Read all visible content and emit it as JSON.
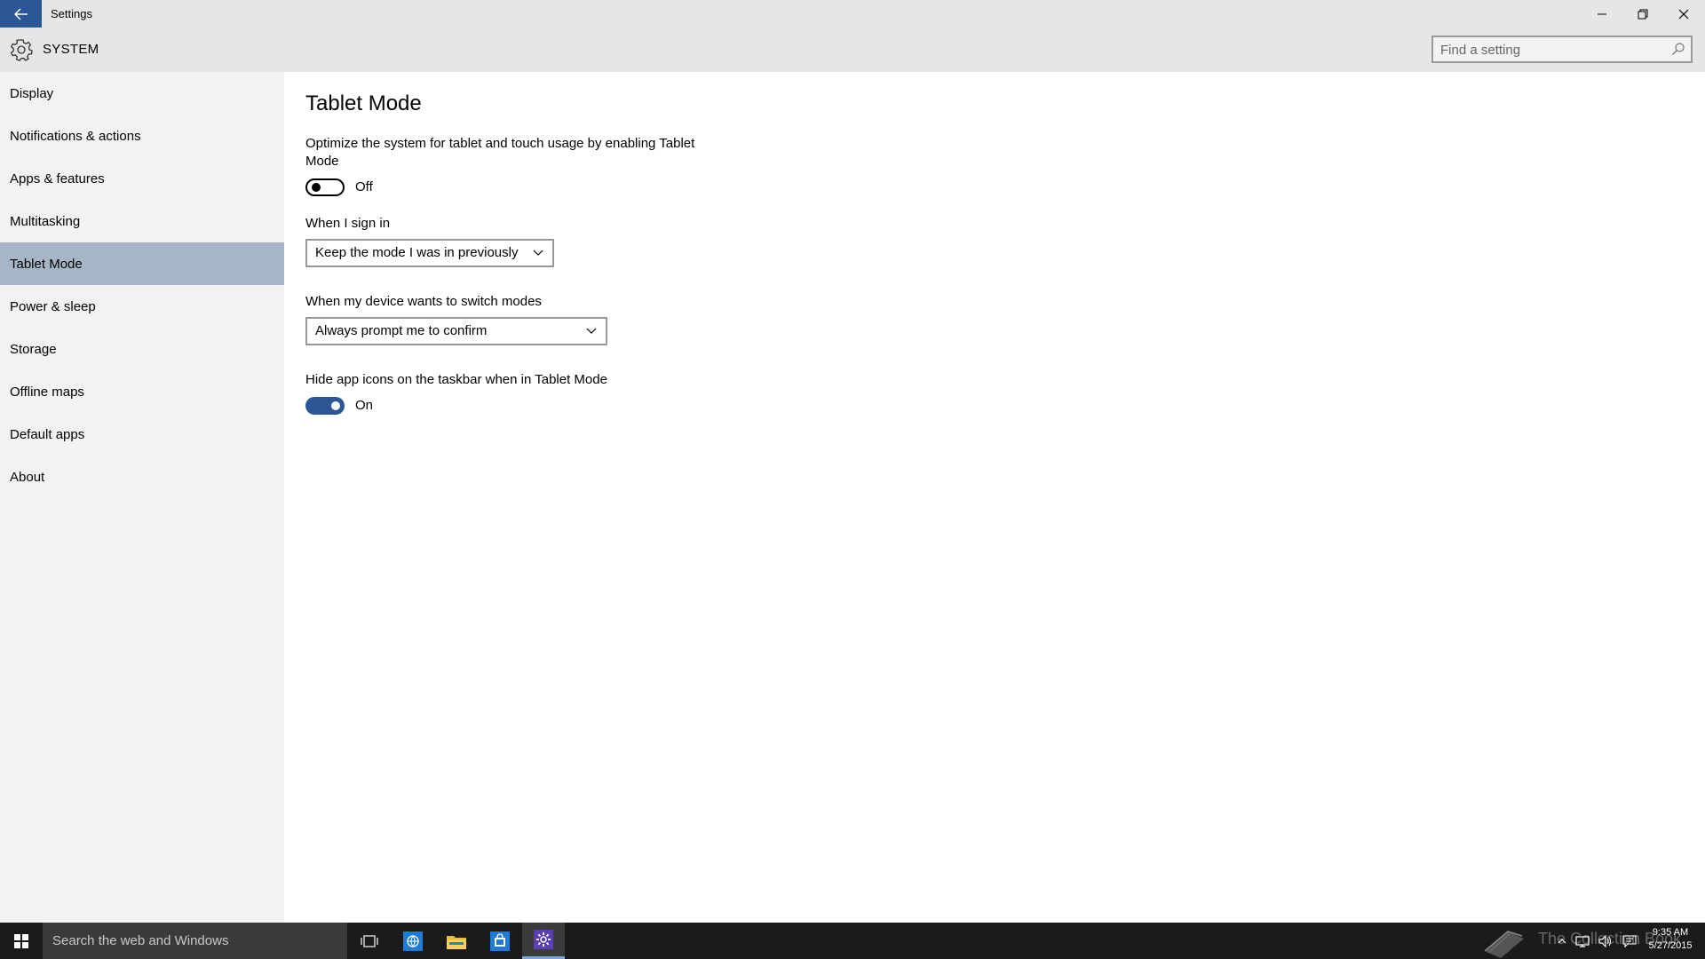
{
  "window": {
    "title": "Settings"
  },
  "header": {
    "title": "SYSTEM",
    "search_placeholder": "Find a setting"
  },
  "sidebar": {
    "items": [
      {
        "label": "Display"
      },
      {
        "label": "Notifications & actions"
      },
      {
        "label": "Apps & features"
      },
      {
        "label": "Multitasking"
      },
      {
        "label": "Tablet Mode",
        "selected": true
      },
      {
        "label": "Power & sleep"
      },
      {
        "label": "Storage"
      },
      {
        "label": "Offline maps"
      },
      {
        "label": "Default apps"
      },
      {
        "label": "About"
      }
    ]
  },
  "main": {
    "title": "Tablet Mode",
    "tablet_mode": {
      "description": "Optimize the system for tablet and touch usage by enabling Tablet Mode",
      "state": "Off"
    },
    "sign_in": {
      "label": "When I sign in",
      "value": "Keep the mode I was in previously"
    },
    "switch_modes": {
      "label": "When my device wants to switch modes",
      "value": "Always prompt me to confirm"
    },
    "hide_icons": {
      "label": "Hide app icons on the taskbar when in Tablet Mode",
      "state": "On"
    }
  },
  "taskbar": {
    "search_text": "Search the web and Windows",
    "watermark": "The Collection Book",
    "time": "9:35 AM",
    "date": "5/27/2015"
  },
  "colors": {
    "accent": "#2b5797",
    "selected_nav": "#a6b6c7",
    "sidebar_bg": "#f2f2f2",
    "titlebar_bg": "#e6e6e6",
    "taskbar_bg": "#1b1b1b"
  }
}
